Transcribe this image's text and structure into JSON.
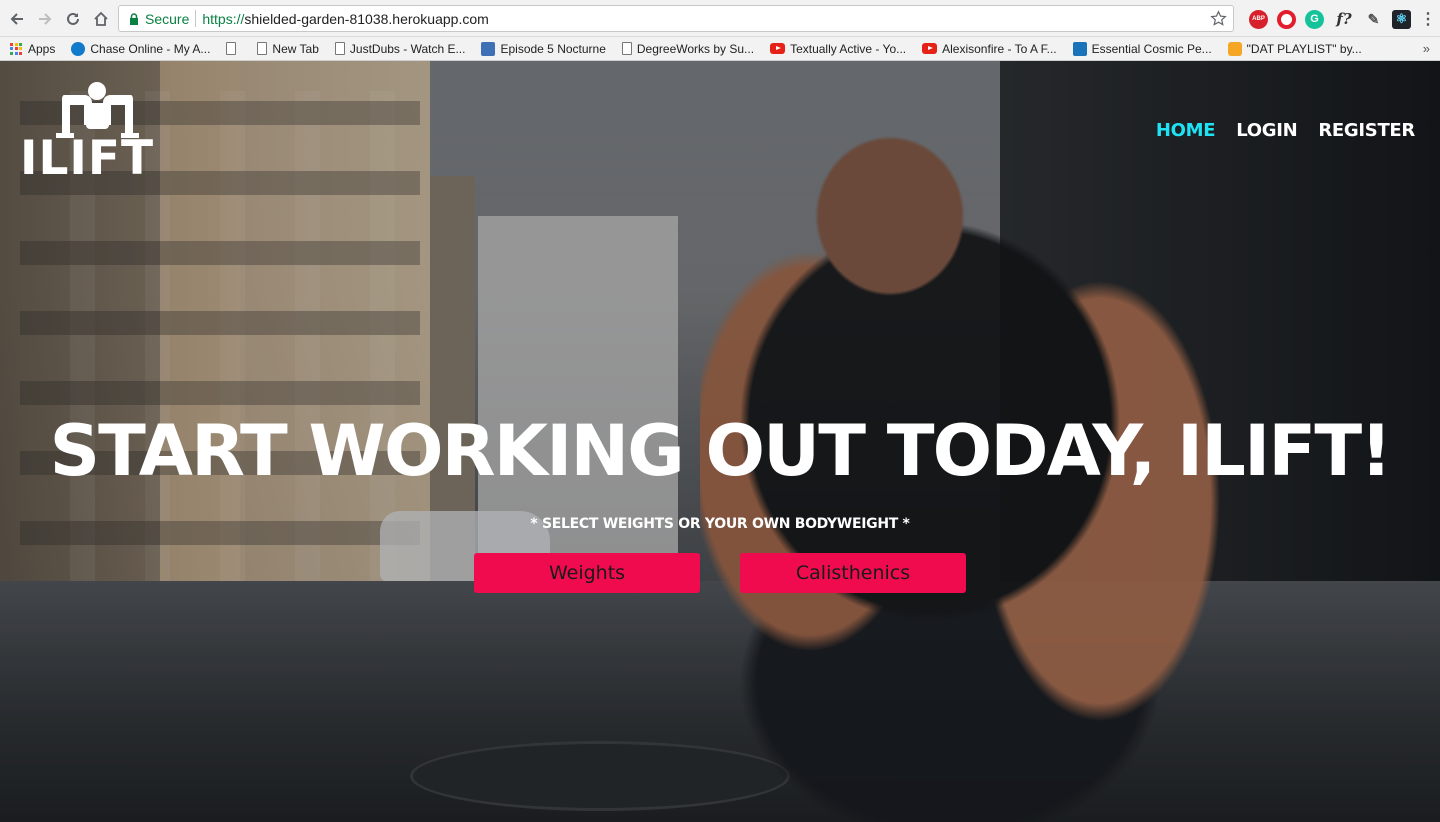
{
  "browser": {
    "secure_label": "Secure",
    "url_scheme": "https://",
    "url_host": "shielded-garden-81038.herokuapp.com",
    "extensions": [
      "ABP",
      "opera-icon",
      "G",
      "f?",
      "eyedropper-icon",
      "react-icon"
    ],
    "accent_secure": "#0b8043"
  },
  "bookmarks": [
    {
      "label": "Apps",
      "icon": "apps-grid-icon"
    },
    {
      "label": "Chase Online - My A...",
      "icon": "chase-icon"
    },
    {
      "label": "",
      "icon": "page-icon"
    },
    {
      "label": "New Tab",
      "icon": "page-icon"
    },
    {
      "label": "JustDubs - Watch E...",
      "icon": "page-icon"
    },
    {
      "label": "Episode 5 Nocturne",
      "icon": "episode-icon"
    },
    {
      "label": "DegreeWorks by Su...",
      "icon": "page-icon"
    },
    {
      "label": "Textually Active - Yo...",
      "icon": "youtube-icon"
    },
    {
      "label": "Alexisonfire - To A F...",
      "icon": "youtube-icon"
    },
    {
      "label": "Essential Cosmic Pe...",
      "icon": "cosmic-icon"
    },
    {
      "label": "\"DAT PLAYLIST\" by...",
      "icon": "playlist-icon"
    }
  ],
  "site": {
    "logo_text": "ILIFT",
    "nav": [
      {
        "label": "HOME",
        "active": true
      },
      {
        "label": "LOGIN",
        "active": false
      },
      {
        "label": "REGISTER",
        "active": false
      }
    ],
    "headline": "START WORKING OUT TODAY, ILIFT!",
    "subheadline": "* SELECT WEIGHTS OR YOUR OWN BODYWEIGHT *",
    "buttons": {
      "weights": "Weights",
      "calisthenics": "Calisthenics"
    },
    "colors": {
      "nav_active": "#1ee3f5",
      "cta": "#ef0b4e"
    }
  }
}
